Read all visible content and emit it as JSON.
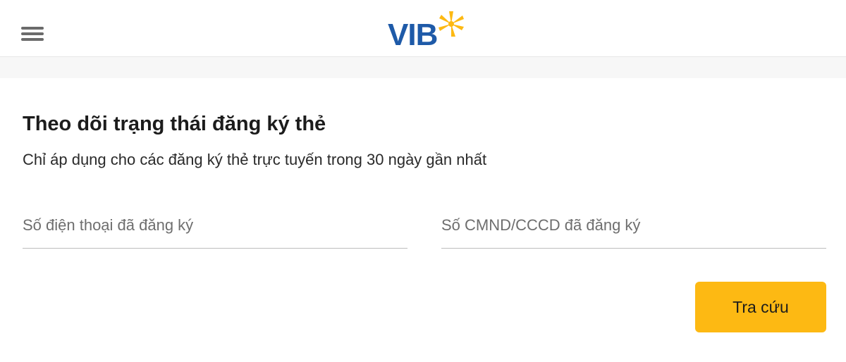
{
  "header": {
    "menu_icon": "hamburger-menu-icon",
    "logo": {
      "text": "VIB",
      "text_color": "#1e5aa8",
      "star_color": "#fdb913"
    }
  },
  "main": {
    "title": "Theo dõi trạng thái đăng ký thẻ",
    "subtitle": "Chỉ áp dụng cho các đăng ký thẻ trực tuyến trong 30 ngày gần nhất",
    "fields": {
      "phone": {
        "value": "",
        "placeholder": "Số điện thoại đã đăng ký"
      },
      "id_number": {
        "value": "",
        "placeholder": "Số CMND/CCCD đã đăng ký"
      }
    },
    "search_button": {
      "label": "Tra cứu",
      "color": "#fdb913"
    }
  }
}
